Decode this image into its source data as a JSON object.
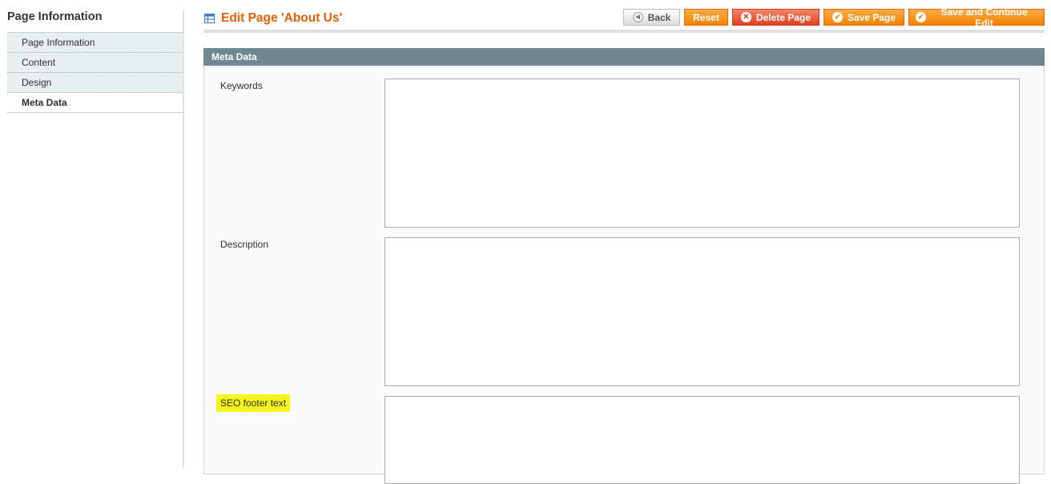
{
  "sidebar": {
    "title": "Page Information",
    "tabs": [
      {
        "label": "Page Information"
      },
      {
        "label": "Content"
      },
      {
        "label": "Design"
      },
      {
        "label": "Meta Data"
      }
    ],
    "active_tab": "Meta Data"
  },
  "header": {
    "title": "Edit Page 'About Us'",
    "title_icon": "page-grid-icon"
  },
  "buttons": {
    "back": {
      "label": "Back",
      "icon": "back-arrow-icon"
    },
    "reset": {
      "label": "Reset"
    },
    "delete": {
      "label": "Delete Page",
      "icon": "delete-circle-icon"
    },
    "save": {
      "label": "Save Page",
      "icon": "checkmark-icon"
    },
    "save_continue": {
      "label": "Save and Continue Edit",
      "icon": "checkmark-icon"
    }
  },
  "fieldset": {
    "title": "Meta Data",
    "fields": [
      {
        "label": "Keywords",
        "value": ""
      },
      {
        "label": "Description",
        "value": ""
      },
      {
        "label": "SEO footer text",
        "value": "",
        "highlighted": true
      }
    ]
  },
  "colors": {
    "accent": "#eb5e00",
    "button": "#f18200",
    "delete_button": "#e0401d",
    "fieldset_header": "#6f8992",
    "highlight": "#f7f51c"
  }
}
